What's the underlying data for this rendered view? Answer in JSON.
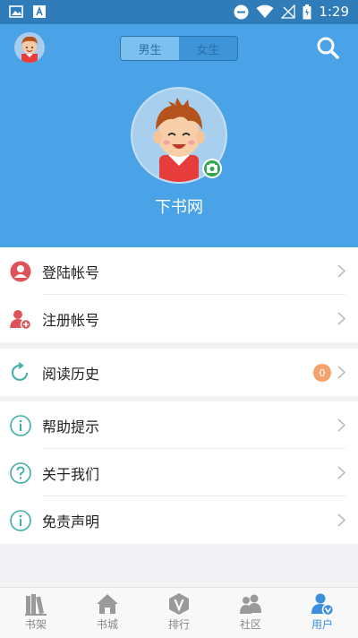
{
  "status_bar": {
    "time": "1:29",
    "icons": [
      "image-icon",
      "text-a-icon",
      "do-not-disturb-icon",
      "wifi-icon",
      "no-signal-icon",
      "battery-icon"
    ]
  },
  "header": {
    "gender_toggle": {
      "male_label": "男生",
      "female_label": "女生",
      "selected": "male"
    },
    "site_name": "下书网",
    "icons": [
      "small-avatar",
      "search-icon",
      "camera-icon"
    ]
  },
  "menu": {
    "account": [
      {
        "label": "登陆帐号",
        "icon": "user-circle-icon"
      },
      {
        "label": "注册帐号",
        "icon": "user-add-icon"
      }
    ],
    "history": {
      "label": "阅读历史",
      "icon": "refresh-icon",
      "count": "0"
    },
    "info": [
      {
        "label": "帮助提示",
        "icon": "info-icon"
      },
      {
        "label": "关于我们",
        "icon": "question-icon"
      },
      {
        "label": "免责声明",
        "icon": "info-icon"
      }
    ]
  },
  "tabbar": {
    "tabs": [
      {
        "label": "书架",
        "icon": "bookshelf-icon"
      },
      {
        "label": "书城",
        "icon": "home-icon"
      },
      {
        "label": "排行",
        "icon": "ranking-icon"
      },
      {
        "label": "社区",
        "icon": "community-icon"
      },
      {
        "label": "用户",
        "icon": "user-icon",
        "active": true
      }
    ]
  },
  "colors": {
    "header_bg": "#4aa3e6",
    "status_bg": "#2f7cb8",
    "accent": "#3b8fdc",
    "red_icon": "#e0525a",
    "teal_icon": "#3dada6",
    "badge": "#f5a36e"
  }
}
